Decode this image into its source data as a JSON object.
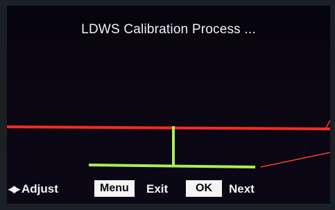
{
  "screen": {
    "title": "LDWS Calibration Process ..."
  },
  "colors": {
    "horizon_line": "#ff2a1f",
    "lane_guide": "#a8ee5a",
    "background": "#07040d"
  },
  "footer": {
    "adjust_icon": "left-right-arrows-icon",
    "adjust_label": "Adjust",
    "menu_key": "Menu",
    "menu_action": "Exit",
    "ok_key": "OK",
    "ok_action": "Next"
  }
}
